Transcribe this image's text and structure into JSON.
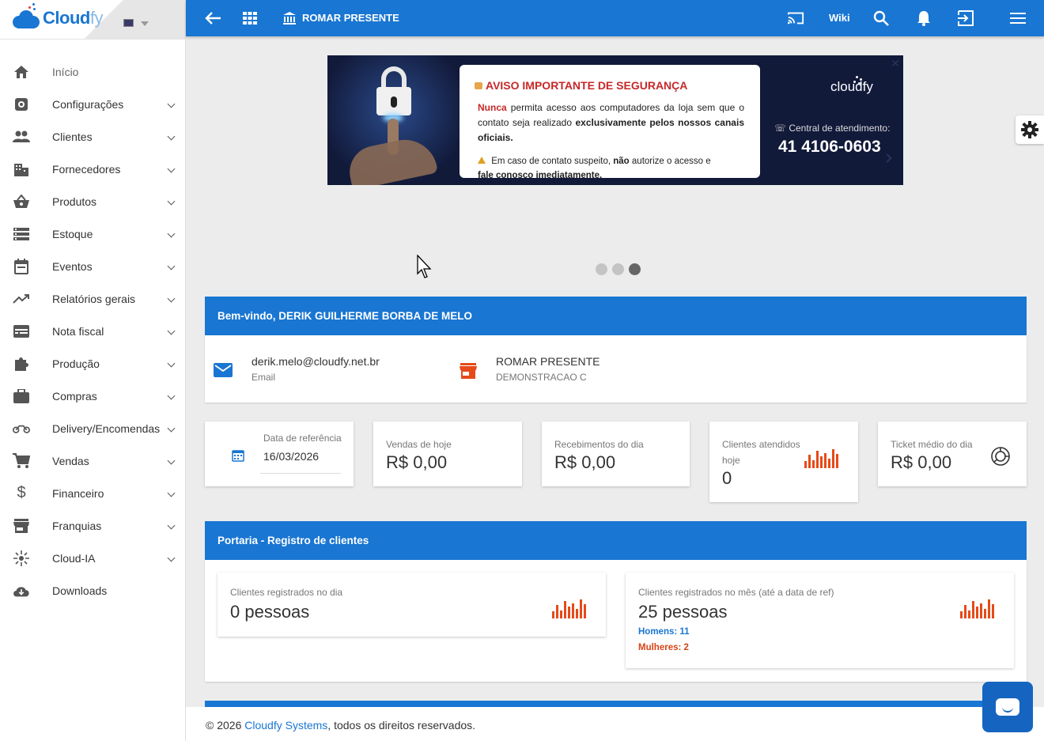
{
  "brand": {
    "logo_text_bold": "Cloud",
    "logo_text_light": "fy"
  },
  "sidebar": {
    "items": [
      {
        "label": "Início",
        "icon": "home-icon",
        "active": true,
        "expandable": false
      },
      {
        "label": "Configurações",
        "icon": "settings-icon",
        "expandable": true
      },
      {
        "label": "Clientes",
        "icon": "people-icon",
        "expandable": true
      },
      {
        "label": "Fornecedores",
        "icon": "building-icon",
        "expandable": true
      },
      {
        "label": "Produtos",
        "icon": "basket-icon",
        "expandable": true
      },
      {
        "label": "Estoque",
        "icon": "storage-icon",
        "expandable": true
      },
      {
        "label": "Eventos",
        "icon": "calendar-icon",
        "expandable": true
      },
      {
        "label": "Relatórios gerais",
        "icon": "trending-icon",
        "expandable": true
      },
      {
        "label": "Nota fiscal",
        "icon": "receipt-icon",
        "expandable": true
      },
      {
        "label": "Produção",
        "icon": "puzzle-icon",
        "expandable": true
      },
      {
        "label": "Compras",
        "icon": "briefcase-icon",
        "expandable": true
      },
      {
        "label": "Delivery/Encomendas",
        "icon": "motorcycle-icon",
        "expandable": true
      },
      {
        "label": "Vendas",
        "icon": "cart-icon",
        "expandable": true
      },
      {
        "label": "Financeiro",
        "icon": "dollar-icon",
        "expandable": true
      },
      {
        "label": "Franquias",
        "icon": "store-icon",
        "expandable": true
      },
      {
        "label": "Cloud-IA",
        "icon": "sparkle-icon",
        "expandable": true
      },
      {
        "label": "Downloads",
        "icon": "cloud-download-icon",
        "expandable": false
      }
    ]
  },
  "topbar": {
    "store_name": "ROMAR PRESENTE",
    "wiki_label": "Wiki",
    "icons": [
      "back-arrow-icon",
      "apps-grid-icon",
      "bank-icon",
      "cast-icon",
      "search-icon",
      "bell-icon",
      "logout-icon",
      "menu-icon"
    ]
  },
  "banner": {
    "title": "AVISO IMPORTANTE DE SEGURANÇA",
    "p1_red": "Nunca",
    "p1_a": " permita acesso aos computadores da loja sem que o contato seja realizado ",
    "p1_bold": "exclusivamente pelos nossos canais oficiais.",
    "p2_a": " Em caso de contato suspeito, ",
    "p2_bold1": "não",
    "p2_b": " autorize o acesso e ",
    "p2_bold2": "fale conosco imediatamente.",
    "brand": "cloudfy",
    "central_label": "Central de atendimento:",
    "phone": "41 4106-0603",
    "slides": 3,
    "active_slide": 3
  },
  "welcome": {
    "title": "Bem-vindo, DERIK GUILHERME BORBA DE MELO",
    "email": "derik.melo@cloudfy.net.br",
    "email_label": "Email",
    "store": "ROMAR PRESENTE",
    "store_sub": "DEMONSTRACAO C"
  },
  "stats": {
    "date_label": "Data de referência",
    "date_value": "16/03/2026",
    "sales_label": "Vendas de hoje",
    "sales_value": "R$ 0,00",
    "receipts_label": "Recebimentos do dia",
    "receipts_value": "R$ 0,00",
    "clients_label": "Clientes atendidos hoje",
    "clients_value": "0",
    "ticket_label": "Ticket médio do dia",
    "ticket_value": "R$ 0,00"
  },
  "portaria": {
    "title": "Portaria - Registro de clientes",
    "day_label": "Clientes registrados no dia",
    "day_value": "0 pessoas",
    "month_label": "Clientes registrados no mês (até a data de ref)",
    "month_value": "25 pessoas",
    "men": "Homens: 11",
    "women": "Mulheres: 2"
  },
  "footer": {
    "prefix": "© 2026 ",
    "link": "Cloudfy Systems",
    "suffix": ", todos os direitos reservados."
  },
  "colors": {
    "primary": "#1976d2",
    "accent_red": "#e64a19",
    "background": "#ececec"
  }
}
